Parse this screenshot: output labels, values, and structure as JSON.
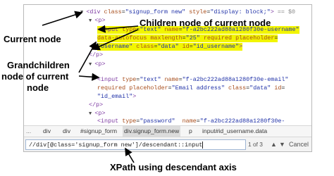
{
  "code_lines": [
    {
      "parts": [
        [
          "arrow",
          "▼ "
        ],
        [
          "tag",
          "<div "
        ],
        [
          "an",
          "class"
        ],
        [
          "plain",
          "="
        ],
        [
          "av",
          "\"signup_form new\""
        ],
        [
          "plain",
          " "
        ],
        [
          "an",
          "style"
        ],
        [
          "plain",
          "="
        ],
        [
          "av",
          "\"display: block;\""
        ],
        [
          "tag",
          ">"
        ],
        [
          "sel",
          " == $0"
        ]
      ]
    },
    {
      "parts": [
        [
          "arrow",
          "▼ "
        ],
        [
          "tag",
          "<p>"
        ]
      ]
    },
    {
      "parts": [
        [
          "tag",
          "<input "
        ],
        [
          "an",
          "type"
        ],
        [
          "plain",
          "="
        ],
        [
          "av",
          "\"text\""
        ],
        [
          "plain",
          " "
        ],
        [
          "an",
          "name"
        ],
        [
          "plain",
          "="
        ],
        [
          "av",
          "\"f-a2bc222ad88a1280f30e-username\""
        ]
      ],
      "hl": true
    },
    {
      "parts": [
        [
          "an",
          "data-autofocus"
        ],
        [
          "plain",
          " "
        ],
        [
          "an",
          "maxlength"
        ],
        [
          "plain",
          "="
        ],
        [
          "av",
          "\"25\""
        ],
        [
          "plain",
          " "
        ],
        [
          "an",
          "required"
        ],
        [
          "plain",
          " "
        ],
        [
          "an",
          "placeholder"
        ],
        [
          "plain",
          "="
        ]
      ],
      "hl": true
    },
    {
      "parts": [
        [
          "av",
          "\"Username\""
        ],
        [
          "plain",
          " "
        ],
        [
          "an",
          "class"
        ],
        [
          "plain",
          "="
        ],
        [
          "av",
          "\"data\""
        ],
        [
          "plain",
          " "
        ],
        [
          "an",
          "id"
        ],
        [
          "plain",
          "="
        ],
        [
          "av",
          "\"id_username\""
        ],
        [
          "tag",
          ">"
        ]
      ],
      "hl": true
    },
    {
      "parts": [
        [
          "tag",
          "</p>"
        ]
      ]
    },
    {
      "parts": [
        [
          "arrow",
          "▼ "
        ],
        [
          "tag",
          "<p>"
        ]
      ]
    },
    {
      "parts": []
    },
    {
      "parts": [
        [
          "tag",
          "<input "
        ],
        [
          "an",
          "type"
        ],
        [
          "plain",
          "="
        ],
        [
          "av",
          "\"text\""
        ],
        [
          "plain",
          " "
        ],
        [
          "an",
          "name"
        ],
        [
          "plain",
          "="
        ],
        [
          "av",
          "\"f-a2bc222ad88a1280f30e-email\""
        ]
      ]
    },
    {
      "parts": [
        [
          "an",
          "required"
        ],
        [
          "plain",
          " "
        ],
        [
          "an",
          "placeholder"
        ],
        [
          "plain",
          "="
        ],
        [
          "av",
          "\"Email address\""
        ],
        [
          "plain",
          " "
        ],
        [
          "an",
          "class"
        ],
        [
          "plain",
          "="
        ],
        [
          "av",
          "\"data\""
        ],
        [
          "plain",
          " "
        ],
        [
          "an",
          "id"
        ],
        [
          "plain",
          "="
        ]
      ]
    },
    {
      "parts": [
        [
          "av",
          "\"id_email\""
        ],
        [
          "tag",
          ">"
        ]
      ]
    },
    {
      "parts": [
        [
          "tag",
          "</p>"
        ]
      ]
    },
    {
      "parts": [
        [
          "arrow",
          "▼ "
        ],
        [
          "tag",
          "<p>"
        ]
      ]
    },
    {
      "parts": [
        [
          "tag",
          "<input "
        ],
        [
          "an",
          "type"
        ],
        [
          "plain",
          "="
        ],
        [
          "av",
          "\"password\""
        ],
        [
          "plain",
          "  "
        ],
        [
          "an",
          "name"
        ],
        [
          "plain",
          "="
        ],
        [
          "av",
          "\"f-a2bc222ad88a1280f30e-"
        ]
      ]
    }
  ],
  "breadcrumbs": {
    "nav": "...",
    "items": [
      "div",
      "div",
      "#signup_form",
      "div.signup_form.new",
      "p",
      "input#id_username.data"
    ]
  },
  "search": {
    "value": "//div[@class='signup_form new']/descendant::input",
    "match_count": "1 of 3",
    "up": "▲",
    "down": "▼",
    "cancel": "Cancel"
  },
  "labels": {
    "children": "Children node of current node",
    "current": "Current node",
    "grandchildren_1": "Grandchildren",
    "grandchildren_2": "node of current",
    "grandchildren_3": "node",
    "caption": "XPath using descendant axis"
  }
}
